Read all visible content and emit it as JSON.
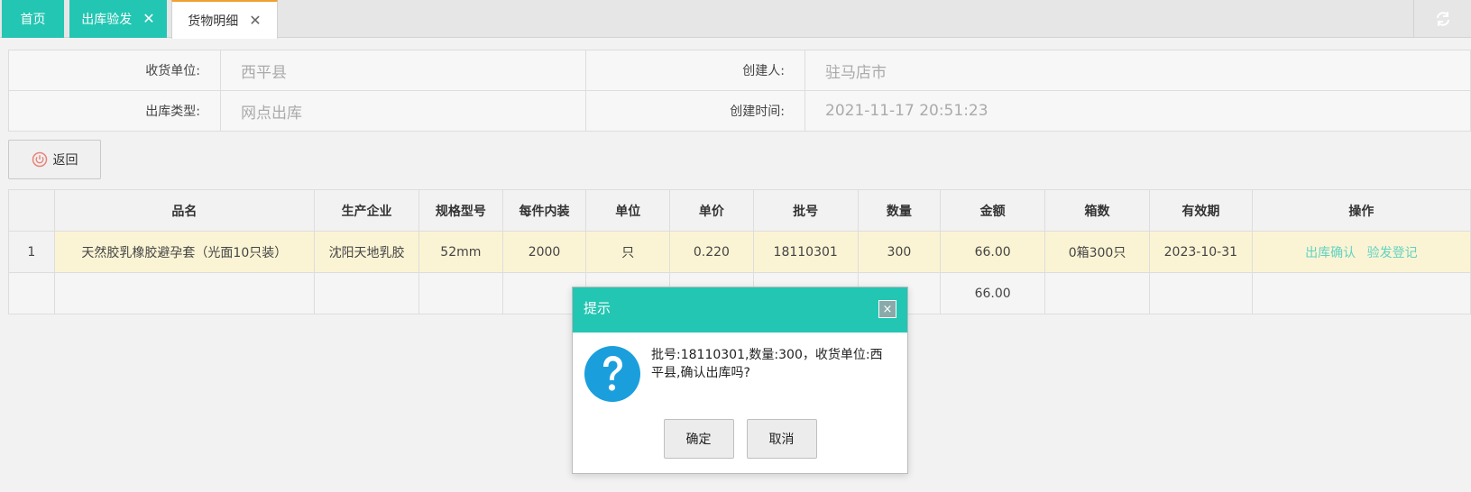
{
  "tabs": [
    {
      "label": "首页",
      "closable": false
    },
    {
      "label": "出库验发",
      "closable": true
    },
    {
      "label": "货物明细",
      "closable": true,
      "active": true
    }
  ],
  "tab_close_glyph": "✕",
  "refresh_icon": "refresh-icon",
  "info": {
    "receiver_label": "收货单位:",
    "receiver_value": "西平县",
    "creator_label": "创建人:",
    "creator_value": "驻马店市",
    "type_label": "出库类型:",
    "type_value": "网点出库",
    "created_label": "创建时间:",
    "created_value": "2021-11-17 20:51:23"
  },
  "back_button": "返回",
  "grid": {
    "columns": [
      "",
      "品名",
      "生产企业",
      "规格型号",
      "每件内装",
      "单位",
      "单价",
      "批号",
      "数量",
      "金额",
      "箱数",
      "有效期",
      "操作"
    ],
    "rows": [
      {
        "num": "1",
        "name": "天然胶乳橡胶避孕套（光面10只装）",
        "maker": "沈阳天地乳胶",
        "spec": "52mm",
        "per_pack": "2000",
        "unit": "只",
        "price": "0.220",
        "batch": "18110301",
        "qty": "300",
        "amount": "66.00",
        "boxes": "0箱300只",
        "expiry": "2023-10-31",
        "op1": "出库确认",
        "op2": "验发登记"
      }
    ],
    "footer": {
      "amount": "66.00"
    }
  },
  "modal": {
    "title": "提示",
    "close_glyph": "×",
    "message": "批号:18110301,数量:300，收货单位:西平县,确认出库吗?",
    "ok": "确定",
    "cancel": "取消"
  },
  "colors": {
    "accent": "#23c6b2",
    "highlight_row": "#fbf4d4",
    "link": "#5fd2c2",
    "active_tab_top": "#f0a030",
    "question_icon": "#1a9fdc"
  }
}
